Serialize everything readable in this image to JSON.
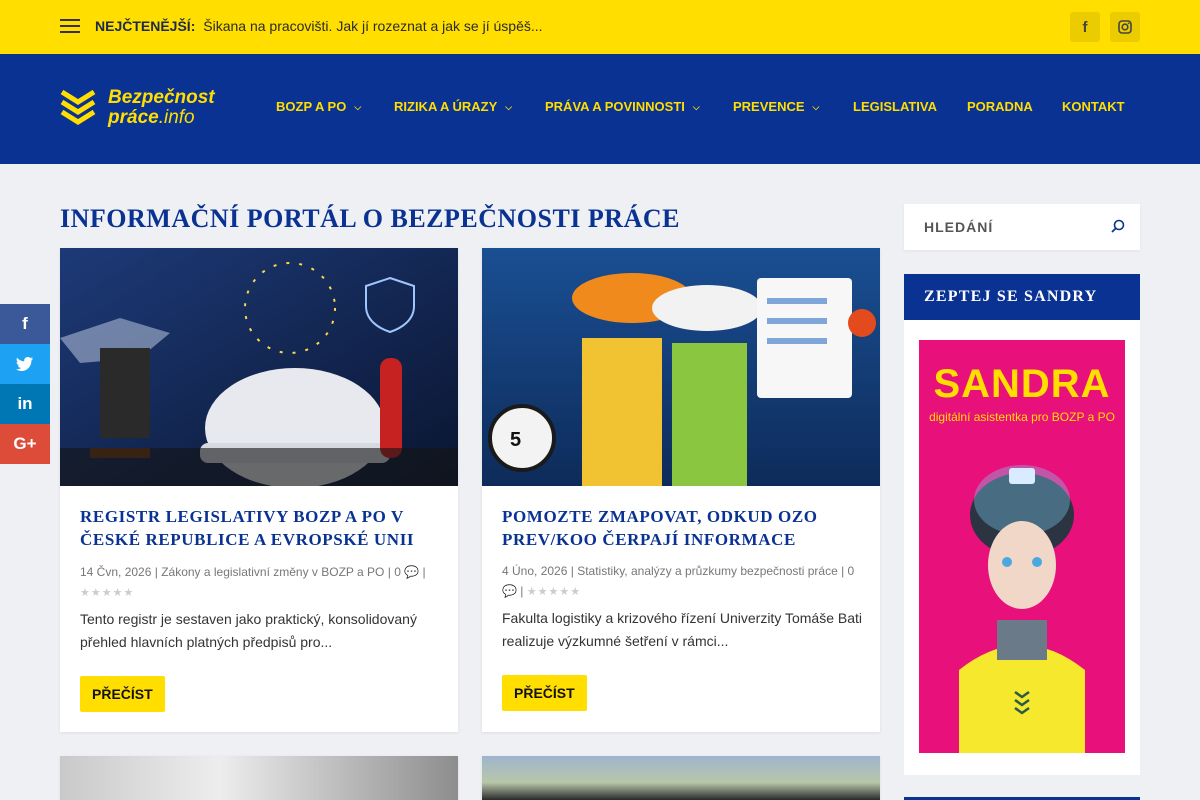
{
  "topbar": {
    "trending_label": "NEJČTENĚJŠÍ:",
    "trending_text": "Šikana na pracovišti. Jak jí rozeznat a jak se jí úspěš...",
    "social": [
      "facebook-icon",
      "instagram-icon"
    ]
  },
  "brand": {
    "line1": "Bezpečnost",
    "line2_a": "práce",
    "line2_b": ".info",
    "color_primary": "#0a3293",
    "color_accent": "#ffde00"
  },
  "nav": {
    "items": [
      {
        "label": "BOZP A PO",
        "dropdown": true
      },
      {
        "label": "RIZIKA A ÚRAZY",
        "dropdown": true
      },
      {
        "label": "PRÁVA A POVINNOSTI",
        "dropdown": true
      },
      {
        "label": "PREVENCE",
        "dropdown": true
      },
      {
        "label": "LEGISLATIVA",
        "dropdown": false
      },
      {
        "label": "PORADNA",
        "dropdown": false
      },
      {
        "label": "KONTAKT",
        "dropdown": false
      }
    ]
  },
  "main": {
    "heading": "INFORMAČNÍ PORTÁL O BEZPEČNOSTI PRÁCE",
    "posts": [
      {
        "title": "REGISTR LEGISLATIVY BOZP A PO V ČESKÉ REPUBLICE A EVROPSKÉ UNII",
        "date": "14 Čvn, 2026",
        "category": "Zákony a legislativní změny v BOZP a PO",
        "comments": "0",
        "excerpt": "Tento registr je sestaven jako praktický, konsolidovaný přehled hlavních platných předpisů pro...",
        "button": "PŘEČÍST"
      },
      {
        "title": "POMOZTE ZMAPOVAT, ODKUD OZO PREV/KOO ČERPAJÍ INFORMACE",
        "date": "4 Úno, 2026",
        "category": "Statistiky, analýzy a průzkumy bezpečnosti práce",
        "comments": "0",
        "excerpt": "Fakulta logistiky a krizového řízení Univerzity Tomáše Bati realizuje výzkumné šetření v rámci...",
        "button": "PŘEČÍST"
      }
    ]
  },
  "share": [
    "facebook-icon",
    "twitter-icon",
    "linkedin-icon",
    "google-plus-icon"
  ],
  "sidebar": {
    "search_placeholder": "HLEDÁNÍ",
    "widget_title": "ZEPTEJ SE SANDRY",
    "banner_title": "SANDRA",
    "banner_subtitle": "digitální asistentka pro BOZP a PO"
  }
}
